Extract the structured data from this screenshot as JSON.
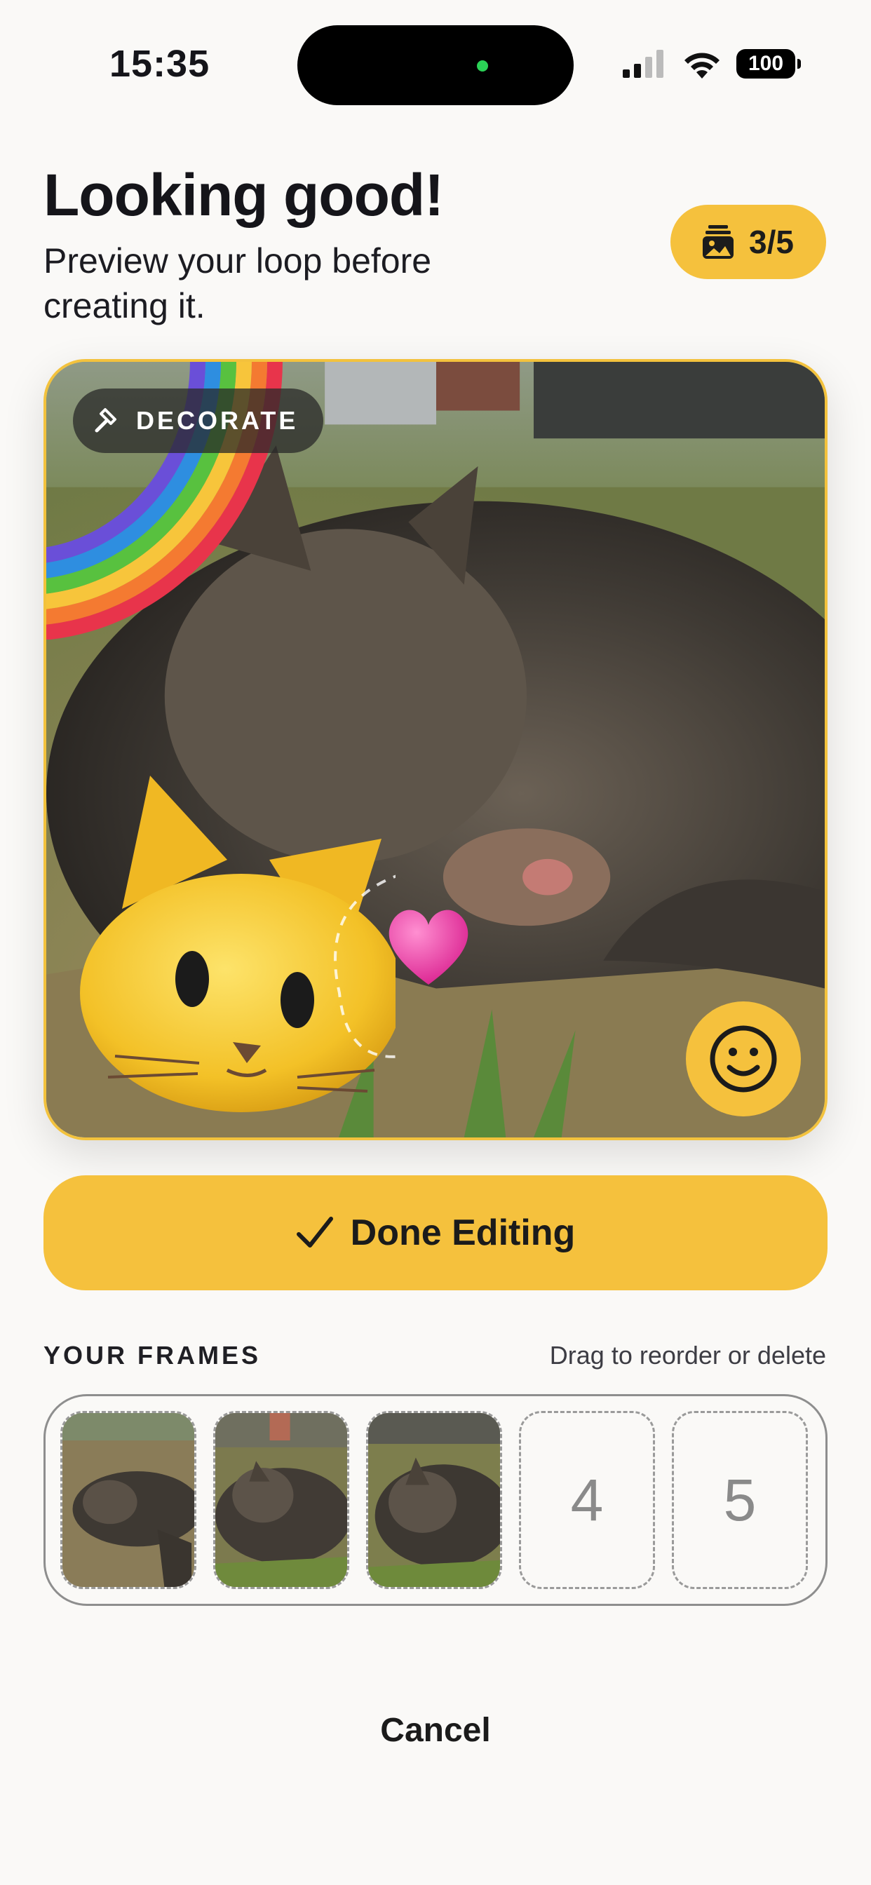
{
  "status_bar": {
    "time": "15:35",
    "battery": "100"
  },
  "header": {
    "title": "Looking good!",
    "subtitle": "Preview your loop before creating it.",
    "frame_count": "3/5"
  },
  "preview": {
    "decorate_label": "DECORATE",
    "stickers": [
      "rainbow-sticker",
      "cat-face-sticker",
      "pink-heart-sticker"
    ]
  },
  "done_button": {
    "label": "Done Editing"
  },
  "frames": {
    "label": "YOUR FRAMES",
    "hint": "Drag to reorder or delete",
    "slots": [
      {
        "filled": true
      },
      {
        "filled": true
      },
      {
        "filled": true
      },
      {
        "filled": false,
        "number": "4"
      },
      {
        "filled": false,
        "number": "5"
      }
    ]
  },
  "cancel": {
    "label": "Cancel"
  },
  "colors": {
    "accent": "#f5c13d",
    "background": "#faf9f7",
    "text": "#15151a"
  }
}
